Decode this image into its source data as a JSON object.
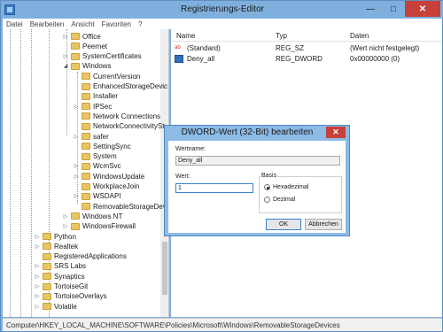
{
  "window": {
    "title": "Registrierungs-Editor",
    "minimize_label": "—",
    "maximize_label": "□",
    "close_label": "✕"
  },
  "menu": {
    "items": [
      "Datei",
      "Bearbeiten",
      "Ansicht",
      "Favoriten",
      "?"
    ]
  },
  "tree": {
    "rows": [
      {
        "label": "Office",
        "expander": "▷"
      },
      {
        "label": "Peernet",
        "expander": ""
      },
      {
        "label": "SystemCertificates",
        "expander": "▷"
      },
      {
        "label": "Windows",
        "expander": "◢"
      },
      {
        "label": "CurrentVersion",
        "expander": ""
      },
      {
        "label": "EnhancedStorageDevic",
        "expander": ""
      },
      {
        "label": "Installer",
        "expander": ""
      },
      {
        "label": "IPSec",
        "expander": "▷"
      },
      {
        "label": "Network Connections",
        "expander": ""
      },
      {
        "label": "NetworkConnectivitySt",
        "expander": ""
      },
      {
        "label": "safer",
        "expander": "▷"
      },
      {
        "label": "SettingSync",
        "expander": ""
      },
      {
        "label": "System",
        "expander": ""
      },
      {
        "label": "WcmSvc",
        "expander": "▷"
      },
      {
        "label": "WindowsUpdate",
        "expander": "▷"
      },
      {
        "label": "WorkplaceJoin",
        "expander": ""
      },
      {
        "label": "WSDAPI",
        "expander": "▷"
      },
      {
        "label": "RemovableStorageDev",
        "expander": ""
      },
      {
        "label": "Windows NT",
        "expander": "▷"
      },
      {
        "label": "WindowsFirewall",
        "expander": "▷"
      },
      {
        "label": "Python",
        "expander": "▷"
      },
      {
        "label": "Realtek",
        "expander": "▷"
      },
      {
        "label": "RegisteredApplications",
        "expander": ""
      },
      {
        "label": "SRS Labs",
        "expander": "▷"
      },
      {
        "label": "Synaptics",
        "expander": "▷"
      },
      {
        "label": "TortoiseGit",
        "expander": "▷"
      },
      {
        "label": "TortoiseOverlays",
        "expander": "▷"
      },
      {
        "label": "Volatile",
        "expander": "▷"
      }
    ]
  },
  "values": {
    "headers": {
      "name": "Name",
      "type": "Typ",
      "data": "Daten"
    },
    "rows": [
      {
        "icon": "ab",
        "name": "(Standard)",
        "type": "REG_SZ",
        "data": "(Wert nicht festgelegt)"
      },
      {
        "icon": "dword",
        "name": "Deny_all",
        "type": "REG_DWORD",
        "data": "0x00000000 (0)"
      }
    ]
  },
  "status": {
    "path": "Computer\\HKEY_LOCAL_MACHINE\\SOFTWARE\\Policies\\Microsoft\\Windows\\RemovableStorageDevices"
  },
  "dialog": {
    "title": "DWORD-Wert (32-Bit) bearbeiten",
    "close_label": "✕",
    "name_label": "Wertname:",
    "name_value": "Deny_all",
    "value_label": "Wert:",
    "value_value": "1",
    "base_label": "Basis",
    "hex_label": "Hexadezimal",
    "dec_label": "Dezimal",
    "base_selected": "Hexadezimal",
    "ok_label": "OK",
    "cancel_label": "Abbrechen"
  },
  "colors": {
    "title_bar": "#7fb0dd",
    "close_red": "#c7403a",
    "folder": "#e9c662"
  }
}
